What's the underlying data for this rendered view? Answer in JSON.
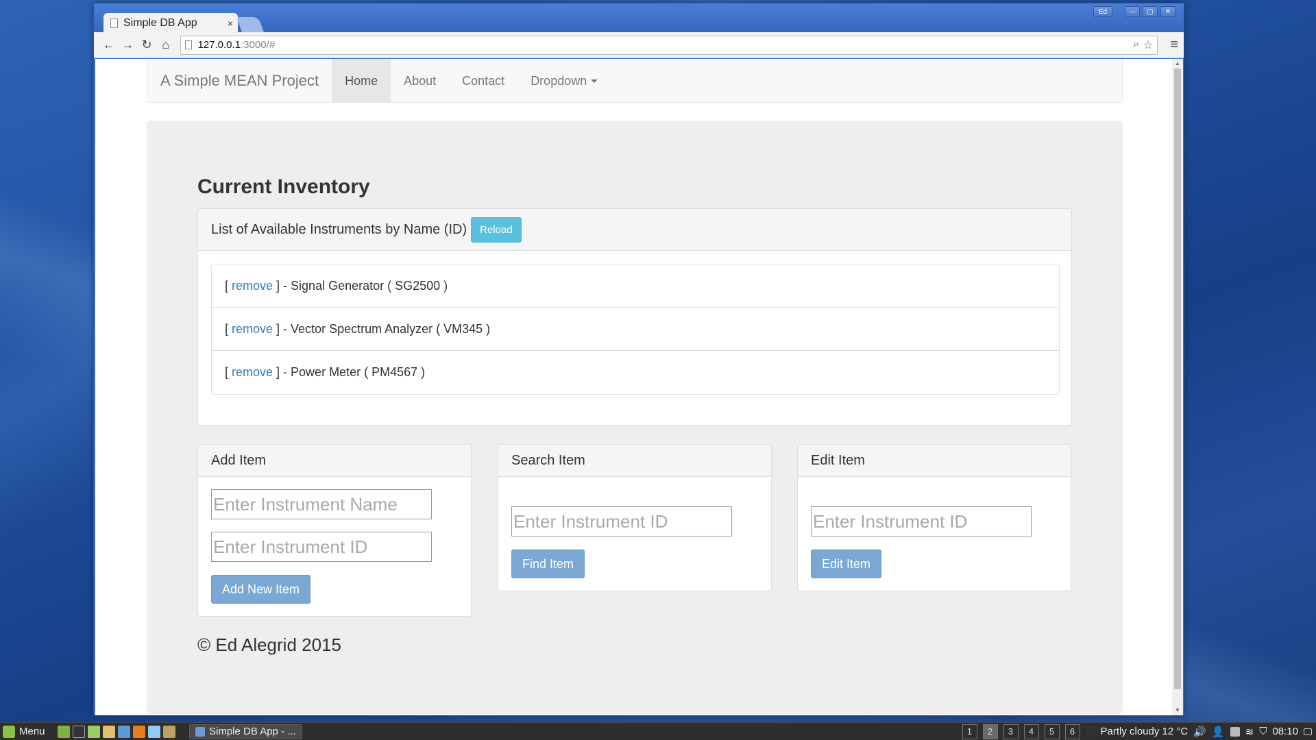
{
  "browser": {
    "tab_title": "Simple DB App",
    "tab_close": "×",
    "url_host": "127.0.0.1",
    "url_rest": ":3000/#",
    "window_user": "Ed"
  },
  "navbar": {
    "brand": "A Simple MEAN Project",
    "items": [
      "Home",
      "About",
      "Contact",
      "Dropdown"
    ]
  },
  "inventory": {
    "title": "Current Inventory",
    "panel_heading": "List of Available Instruments by Name (ID)",
    "reload_label": "Reload",
    "remove_label": "remove",
    "items": [
      {
        "prefix": "[",
        "suffix": "] - Signal Generator ( SG2500 )"
      },
      {
        "prefix": "[",
        "suffix": "] - Vector Spectrum Analyzer ( VM345 )"
      },
      {
        "prefix": "[",
        "suffix": "] - Power Meter ( PM4567 )"
      }
    ]
  },
  "add_item": {
    "heading": "Add Item",
    "name_placeholder": "Enter Instrument Name",
    "id_placeholder": "Enter Instrument ID",
    "button": "Add New Item"
  },
  "search_item": {
    "heading": "Search Item",
    "id_placeholder": "Enter Instrument ID",
    "button": "Find Item"
  },
  "edit_item": {
    "heading": "Edit Item",
    "id_placeholder": "Enter Instrument ID",
    "button": "Edit Item"
  },
  "footer": {
    "text": "© Ed Alegrid 2015"
  },
  "taskbar": {
    "menu_label": "Menu",
    "task_label": "Simple DB App - ...",
    "workspaces": [
      "1",
      "2",
      "3",
      "4",
      "5",
      "6"
    ],
    "active_workspace": "2",
    "weather": "Partly cloudy 12 °C",
    "clock": "08:10"
  }
}
